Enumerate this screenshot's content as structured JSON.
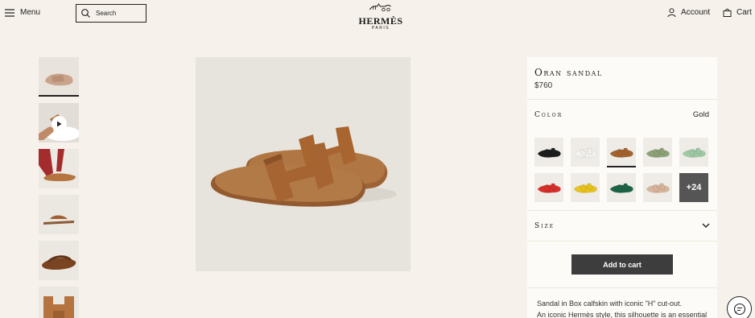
{
  "header": {
    "menu_label": "Menu",
    "search_placeholder": "Search",
    "logo_word": "HERMÈS",
    "logo_city": "PARIS",
    "account_label": "Account",
    "cart_label": "Cart"
  },
  "product": {
    "name": "Oran sandal",
    "price": "$760",
    "color_label": "Color",
    "color_value": "Gold",
    "size_label": "Size",
    "add_to_cart": "Add to cart",
    "more_colors": "+24",
    "description_lines": [
      "Sandal in Box calfskin with iconic \"H\" cut-out.",
      "An iconic Hermès style, this silhouette is an essential"
    ]
  },
  "thumbnails": [
    {
      "name": "thumb-top-view",
      "tone": "#c9a38a",
      "bg": "#e8e3dc"
    },
    {
      "name": "thumb-video",
      "tone": "#a86a3c",
      "bg": "#e2ddd6"
    },
    {
      "name": "thumb-worn",
      "tone": "#a52c2c",
      "bg": "#ece8e2"
    },
    {
      "name": "thumb-side",
      "tone": "#a06034",
      "bg": "#ebe7e1"
    },
    {
      "name": "thumb-sole",
      "tone": "#7a4422",
      "bg": "#ebe7e1"
    },
    {
      "name": "thumb-closeup",
      "tone": "#b4733f",
      "bg": "#ebe7e1"
    }
  ],
  "swatches": [
    {
      "name": "swatch-black",
      "color": "#1e1e1e"
    },
    {
      "name": "swatch-white",
      "color": "#f4f2ee"
    },
    {
      "name": "swatch-gold",
      "color": "#a4622f",
      "selected": true
    },
    {
      "name": "swatch-sage",
      "color": "#8da277"
    },
    {
      "name": "swatch-mint",
      "color": "#9fc9a5"
    },
    {
      "name": "swatch-red",
      "color": "#d82f2a"
    },
    {
      "name": "swatch-yellow",
      "color": "#e8c31f"
    },
    {
      "name": "swatch-green",
      "color": "#1e6446"
    },
    {
      "name": "swatch-nude",
      "color": "#d8b49a"
    }
  ],
  "colors": {
    "background": "#f6f1eb",
    "panel": "#fdfbf7",
    "button": "#3d3d3d",
    "sandal_main": "#a86a3c"
  }
}
